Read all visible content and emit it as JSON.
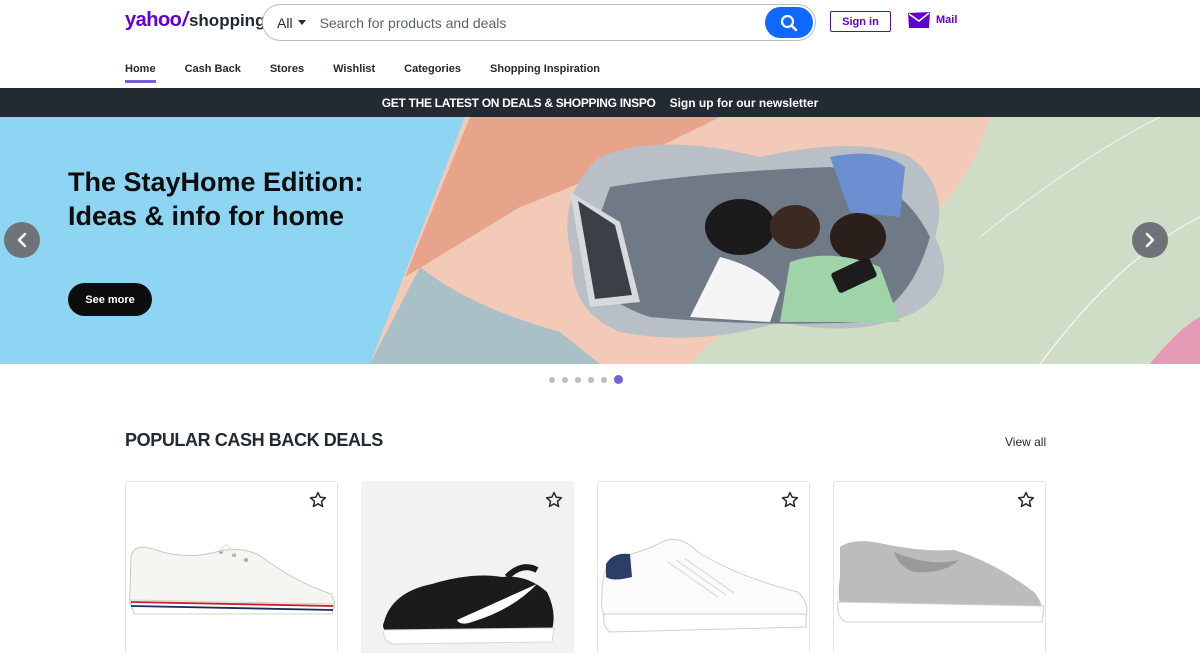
{
  "header": {
    "logo_brand": "yahoo",
    "logo_slash": "/",
    "logo_product": "shopping",
    "search_scope": "All",
    "search_placeholder": "Search for products and deals",
    "signin_label": "Sign in",
    "mail_label": "Mail"
  },
  "nav": {
    "items": [
      {
        "label": "Home"
      },
      {
        "label": "Cash Back"
      },
      {
        "label": "Stores"
      },
      {
        "label": "Wishlist"
      },
      {
        "label": "Categories"
      },
      {
        "label": "Shopping Inspiration"
      }
    ]
  },
  "strip": {
    "promo": "GET THE LATEST ON DEALS & SHOPPING INSPO",
    "newsletter": "Sign up for our newsletter"
  },
  "hero": {
    "title": "The StayHome Edition: Ideas & info for home",
    "cta": "See more",
    "slide_count": 6,
    "active_slide": 6
  },
  "section": {
    "title": "POPULAR CASH BACK DEALS",
    "view_all": "View all"
  },
  "products": [
    {
      "icon": "white-canvas-sneaker"
    },
    {
      "icon": "black-nike-running-shoe"
    },
    {
      "icon": "white-leather-sneaker"
    },
    {
      "icon": "grey-slip-on-shoe"
    }
  ],
  "colors": {
    "brand": "#6001d2",
    "search_button": "#0f69ff",
    "strip_bg": "#232a31",
    "hero_bg": "#8ed5f3",
    "active_dot": "#7b5fd6"
  }
}
